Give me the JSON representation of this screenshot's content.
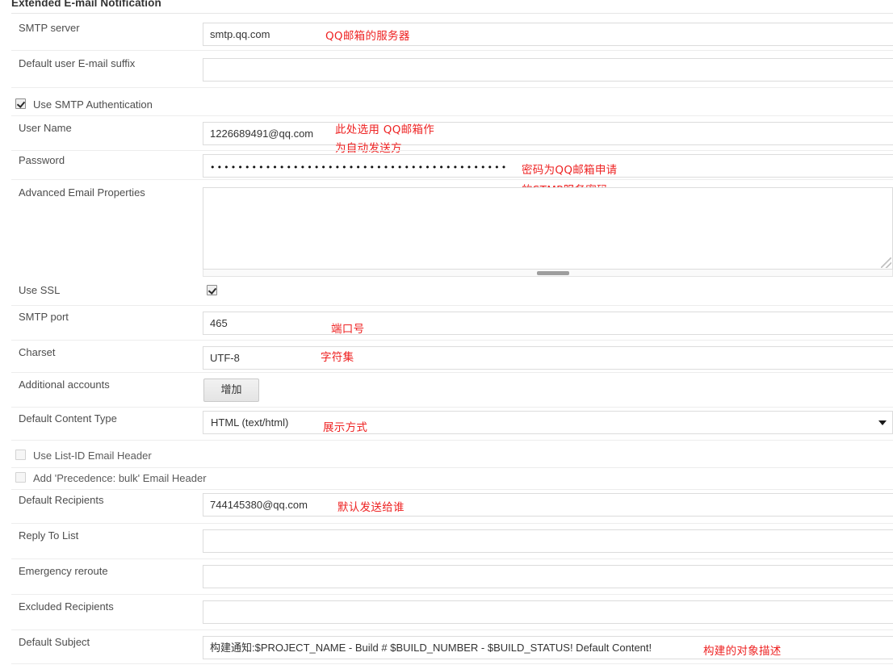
{
  "section": {
    "title": "Extended E-mail Notification"
  },
  "fields": {
    "smtp_server": {
      "label": "SMTP server",
      "value": "smtp.qq.com"
    },
    "default_suffix": {
      "label": "Default user E-mail suffix",
      "value": ""
    },
    "use_smtp_auth": {
      "label": "Use SMTP Authentication",
      "checked": true
    },
    "user_name": {
      "label": "User Name",
      "value": "1226689491@qq.com"
    },
    "password": {
      "label": "Password",
      "value": "••••••••••••••••••••••••••••••••••••••••••••••••••••••••••••••••••"
    },
    "advanced_email_properties": {
      "label": "Advanced Email Properties",
      "value": ""
    },
    "use_ssl": {
      "label": "Use SSL",
      "checked": true
    },
    "smtp_port": {
      "label": "SMTP port",
      "value": "465"
    },
    "charset": {
      "label": "Charset",
      "value": "UTF-8"
    },
    "additional_accounts": {
      "label": "Additional accounts",
      "button_label": "增加"
    },
    "default_content_type": {
      "label": "Default Content Type",
      "value": "HTML (text/html)"
    },
    "use_listid_header": {
      "label": "Use List-ID Email Header",
      "checked": false
    },
    "add_precedence_bulk": {
      "label": "Add 'Precedence: bulk' Email Header",
      "checked": false
    },
    "default_recipients": {
      "label": "Default Recipients",
      "value": "744145380@qq.com"
    },
    "reply_to_list": {
      "label": "Reply To List",
      "value": ""
    },
    "emergency_reroute": {
      "label": "Emergency reroute",
      "value": ""
    },
    "excluded_recipients": {
      "label": "Excluded Recipients",
      "value": ""
    },
    "default_subject": {
      "label": "Default Subject",
      "value": "构建通知:$PROJECT_NAME - Build # $BUILD_NUMBER - $BUILD_STATUS!  Default Content!"
    }
  },
  "annotations": {
    "color": "#ee2222",
    "smtp_server": "QQ邮箱的服务器",
    "user_name_line1": "此处选用 QQ邮箱作",
    "user_name_line2": "为自动发送方",
    "password_line1": "密码为QQ邮箱申请",
    "password_line2": "的STMP服务密码",
    "smtp_port": "端口号",
    "charset": "字符集",
    "content_type": "展示方式",
    "default_recipients": "默认发送给谁",
    "default_subject": "构建的对象描述"
  }
}
